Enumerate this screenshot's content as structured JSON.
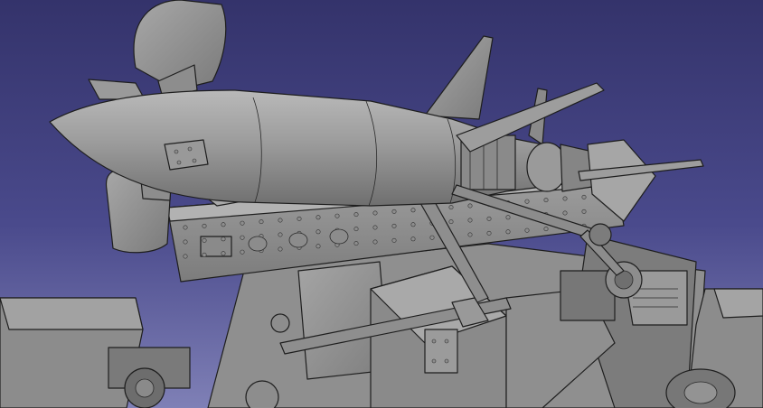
{
  "viewport": {
    "background_top": "#34336b",
    "background_bottom": "#7f80b6",
    "model_color": "#9e9e9e",
    "edge_color": "#1e1e1e"
  },
  "scene": {
    "subject": "",
    "rivet_rows": 3
  }
}
